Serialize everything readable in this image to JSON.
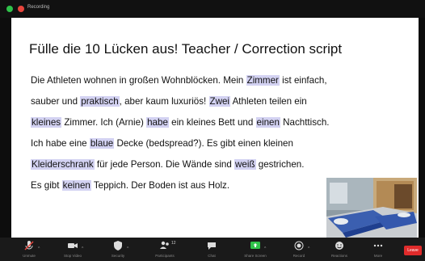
{
  "window": {
    "recording_label": "Recording"
  },
  "slide": {
    "title": "Fülle die 10 Lücken aus!  Teacher / Correction script",
    "lines": [
      [
        {
          "t": "Die Athleten wohnen in großen Wohnblöcken. Mein "
        },
        {
          "t": "Zimmer",
          "h": true
        },
        {
          "t": " ist einfach,"
        }
      ],
      [
        {
          "t": "sauber und "
        },
        {
          "t": "praktisch",
          "h": true
        },
        {
          "t": ", aber kaum luxuriös! "
        },
        {
          "t": "Zwei",
          "h": true
        },
        {
          "t": " Athleten teilen ein"
        }
      ],
      [
        {
          "t": "kleines",
          "h": true
        },
        {
          "t": " Zimmer. Ich (Arnie) "
        },
        {
          "t": "habe",
          "h": true
        },
        {
          "t": " ein kleines Bett und "
        },
        {
          "t": "einen",
          "h": true
        },
        {
          "t": " Nachttisch."
        }
      ],
      [
        {
          "t": "Ich habe eine "
        },
        {
          "t": "blaue",
          "h": true
        },
        {
          "t": " Decke (bedspread?). Es gibt einen kleinen"
        }
      ],
      [
        {
          "t": "Kleiderschrank",
          "h": true
        },
        {
          "t": " für jede Person. Die Wände sind "
        },
        {
          "t": "weiß",
          "h": true
        },
        {
          "t": " gestrichen."
        }
      ],
      [
        {
          "t": "Es gibt "
        },
        {
          "t": "keinen",
          "h": true
        },
        {
          "t": " Teppich. Der Boden ist aus Holz."
        }
      ]
    ]
  },
  "toolbar": {
    "buttons": [
      {
        "label": "Unmute",
        "icon": "microphone-muted-icon"
      },
      {
        "label": "Stop Video",
        "icon": "video-camera-icon"
      },
      {
        "label": "Security",
        "icon": "shield-icon"
      },
      {
        "label": "Participants",
        "icon": "participants-icon",
        "count": "12"
      },
      {
        "label": "Chat",
        "icon": "chat-icon"
      },
      {
        "label": "Share Screen",
        "icon": "share-screen-icon"
      },
      {
        "label": "Record",
        "icon": "record-icon"
      },
      {
        "label": "Reactions",
        "icon": "reactions-icon"
      },
      {
        "label": "More",
        "icon": "more-icon"
      }
    ],
    "leave_label": "Leave"
  },
  "colors": {
    "highlight": "#d3d2f2",
    "share_green": "#2fc24a",
    "leave_red": "#e02b2b"
  }
}
